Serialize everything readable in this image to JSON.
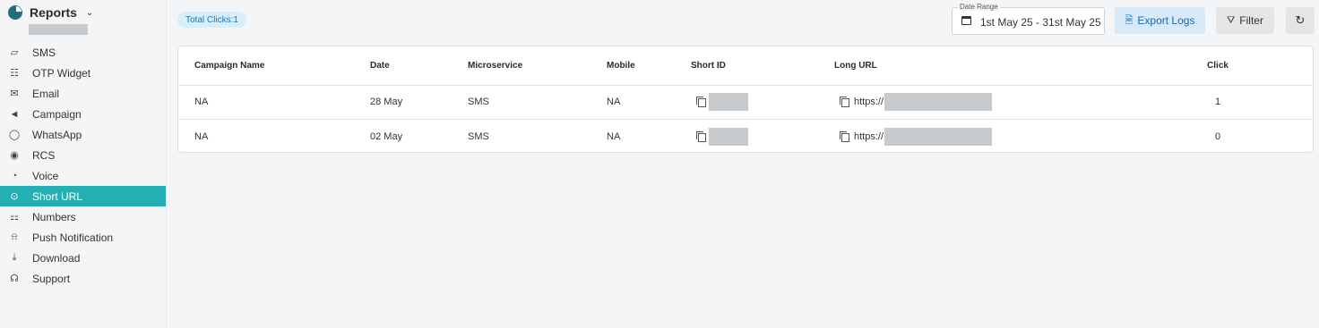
{
  "app": {
    "title": "Reports"
  },
  "sidebar": {
    "items": [
      {
        "label": "SMS",
        "icon": "sms-icon",
        "glyph": "▱"
      },
      {
        "label": "OTP Widget",
        "icon": "otp-widget-icon",
        "glyph": "☷"
      },
      {
        "label": "Email",
        "icon": "email-icon",
        "glyph": "✉"
      },
      {
        "label": "Campaign",
        "icon": "campaign-icon",
        "glyph": "📢"
      },
      {
        "label": "WhatsApp",
        "icon": "whatsapp-icon",
        "glyph": "◯"
      },
      {
        "label": "RCS",
        "icon": "rcs-icon",
        "glyph": "◉"
      },
      {
        "label": "Voice",
        "icon": "voice-icon",
        "glyph": "◔"
      },
      {
        "label": "Short URL",
        "icon": "short-url-icon",
        "glyph": "⊙",
        "active": true
      },
      {
        "label": "Numbers",
        "icon": "numbers-icon",
        "glyph": "⚏"
      },
      {
        "label": "Push Notification",
        "icon": "bell-icon",
        "glyph": "⍾"
      },
      {
        "label": "Download",
        "icon": "download-icon",
        "glyph": "⤓"
      },
      {
        "label": "Support",
        "icon": "headset-icon",
        "glyph": "☊"
      }
    ]
  },
  "toolbar": {
    "total_clicks": "Total Clicks:1",
    "date_range_label": "Date Range",
    "date_range_value": "1st May 25 - 31st May 25",
    "export_label": "Export Logs",
    "filter_label": "Filter"
  },
  "table": {
    "headers": {
      "campaign": "Campaign Name",
      "date": "Date",
      "microservice": "Microservice",
      "mobile": "Mobile",
      "short_id": "Short ID",
      "long_url": "Long URL",
      "click": "Click"
    },
    "rows": [
      {
        "campaign": "NA",
        "date": "28 May",
        "microservice": "SMS",
        "mobile": "NA",
        "long_url_prefix": "https://",
        "click": "1"
      },
      {
        "campaign": "NA",
        "date": "02 May",
        "microservice": "SMS",
        "mobile": "NA",
        "long_url_prefix": "https://",
        "click": "0"
      }
    ]
  },
  "colors": {
    "accent": "#24afb5",
    "badge_bg": "#d8eef9",
    "export_bg": "#d8eaf8"
  }
}
